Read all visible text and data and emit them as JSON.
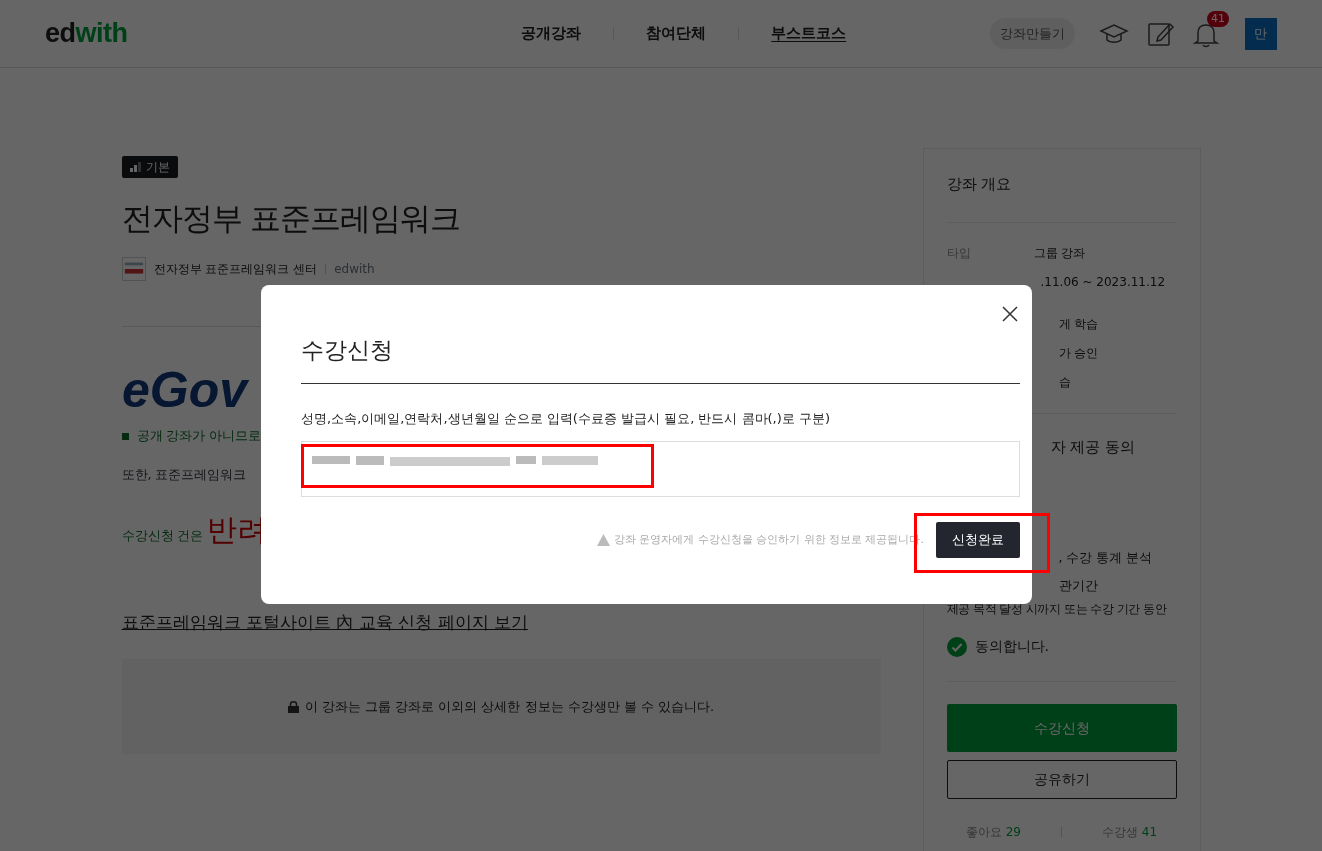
{
  "header": {
    "logo": [
      "ed",
      "with"
    ],
    "nav": [
      {
        "label": "공개강좌",
        "selected": false
      },
      {
        "label": "참여단체",
        "selected": false
      },
      {
        "label": "부스트코스",
        "selected": true
      }
    ],
    "create_button": "강좌만들기",
    "notification_count": "41",
    "avatar": "만"
  },
  "course": {
    "level_badge": "기본",
    "title": "전자정부 표준프레임워크",
    "organization": "전자정부 표준프레임워크 센터",
    "platform": "edwith",
    "logo_text": "eGov",
    "notices": [
      {
        "kind": "bullet",
        "text": "공개 강좌가 아니므로"
      },
      {
        "kind": "plain",
        "text": "또한, 표준프레임워크"
      },
      {
        "kind": "reject",
        "text": "수강신청 건은",
        "emphasis": "반려"
      }
    ],
    "link": "표준프레임워크 포털사이트 內 교육 신청 페이지 보기",
    "locked_notice": "이 강좌는 그룹 강좌로 이외의 상세한 정보는 수강생만 볼 수 있습니다."
  },
  "sidebar": {
    "title": "강좌 개요",
    "rows": [
      {
        "kind": "pair",
        "label": "타입",
        "value": "그룹 강좌"
      },
      {
        "kind": "date",
        "value": ".11.06 ~ 2023.11.12"
      },
      {
        "kind": "fragment",
        "value": "게 학습"
      },
      {
        "kind": "fragment",
        "value": "가 승인"
      },
      {
        "kind": "fragment",
        "value": "습"
      }
    ],
    "consent_title": "자 제공 동의",
    "consent_rows": [
      {
        "kind": "fragment",
        "value": ", 수강 통계 분석"
      },
      {
        "kind": "fragment",
        "value": "관기간"
      },
      {
        "kind": "full",
        "value": "제공 목적 달성 시까지 또는 수강 기간 동안"
      }
    ],
    "agree": {
      "label": "동의합니다.",
      "checked": true
    },
    "enroll_button": "수강신청",
    "share_button": "공유하기",
    "stats": [
      {
        "label": "좋아요",
        "value": "29"
      },
      {
        "label": "수강생",
        "value": "41"
      }
    ]
  },
  "modal": {
    "title": "수강신청",
    "field_label": "성명,소속,이메일,연락처,생년월일 순으로 입력(수료증 발급시 필요, 반드시 콤마(,)로 구분)",
    "field": {
      "redacted": true,
      "highlighted": true
    },
    "notice": "강좌 운영자에게 수강신청을 승인하기 위한 정보로 제공됩니다.",
    "submit_button": {
      "label": "신청완료",
      "highlighted": true
    }
  }
}
